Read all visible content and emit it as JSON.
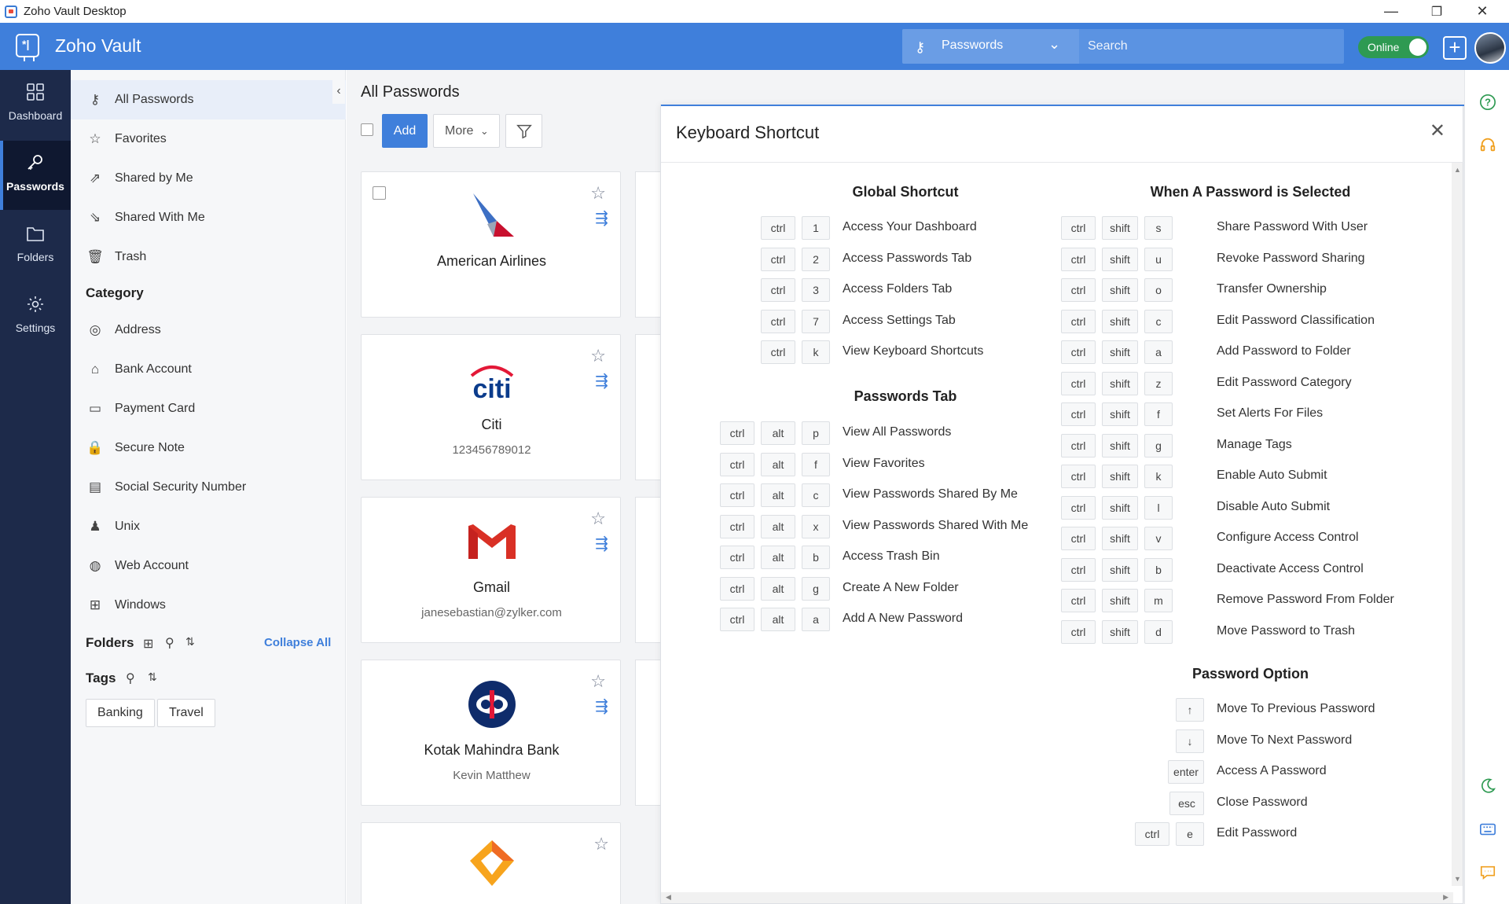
{
  "window": {
    "title": "Zoho Vault Desktop",
    "min": "—",
    "restore": "❐",
    "close": "✕"
  },
  "header": {
    "brand": "Zoho Vault",
    "search_scope": "Passwords",
    "search_placeholder": "Search",
    "online_label": "Online"
  },
  "nav": [
    {
      "label": "Dashboard",
      "icon": "grid-icon"
    },
    {
      "label": "Passwords",
      "icon": "key-icon",
      "active": true
    },
    {
      "label": "Folders",
      "icon": "folder-icon"
    },
    {
      "label": "Settings",
      "icon": "gear-icon"
    }
  ],
  "sidebar": {
    "items": [
      {
        "label": "All Passwords",
        "icon": "all-passwords-icon",
        "glyph": "⚷"
      },
      {
        "label": "Favorites",
        "icon": "star-icon",
        "glyph": "☆"
      },
      {
        "label": "Shared by Me",
        "icon": "share-out-icon",
        "glyph": "⇗"
      },
      {
        "label": "Shared With Me",
        "icon": "share-in-icon",
        "glyph": "⇘"
      },
      {
        "label": "Trash",
        "icon": "trash-icon",
        "glyph": "🗑"
      }
    ],
    "category_heading": "Category",
    "categories": [
      {
        "label": "Address",
        "icon": "address-icon",
        "glyph": "◎"
      },
      {
        "label": "Bank Account",
        "icon": "bank-icon",
        "glyph": "⌂"
      },
      {
        "label": "Payment Card",
        "icon": "card-icon",
        "glyph": "▭"
      },
      {
        "label": "Secure Note",
        "icon": "secure-note-icon",
        "glyph": "🔒"
      },
      {
        "label": "Social Security Number",
        "icon": "ssn-icon",
        "glyph": "▤"
      },
      {
        "label": "Unix",
        "icon": "linux-icon",
        "glyph": "♟"
      },
      {
        "label": "Web Account",
        "icon": "globe-icon",
        "glyph": "◍"
      },
      {
        "label": "Windows",
        "icon": "windows-icon",
        "glyph": "⊞"
      }
    ],
    "folders_heading": "Folders",
    "collapse_all": "Collapse All",
    "tags_heading": "Tags",
    "tags": [
      "Banking",
      "Travel"
    ]
  },
  "main": {
    "title": "All Passwords",
    "add_label": "Add",
    "more_label": "More",
    "cards": [
      {
        "name": "American Airlines",
        "sub": ""
      },
      {
        "name": "Citi",
        "sub": "123456789012"
      },
      {
        "name": "Gmail",
        "sub": "janesebastian@zylker.com"
      },
      {
        "name": "Kotak Mahindra Bank",
        "sub": "Kevin Matthew"
      },
      {
        "name": "",
        "sub": ""
      }
    ]
  },
  "modal": {
    "title": "Keyboard Shortcut",
    "global": {
      "heading": "Global Shortcut",
      "rows": [
        {
          "keys": [
            "ctrl",
            "1"
          ],
          "label": "Access Your Dashboard"
        },
        {
          "keys": [
            "ctrl",
            "2"
          ],
          "label": "Access Passwords Tab"
        },
        {
          "keys": [
            "ctrl",
            "3"
          ],
          "label": "Access Folders Tab"
        },
        {
          "keys": [
            "ctrl",
            "7"
          ],
          "label": "Access Settings Tab"
        },
        {
          "keys": [
            "ctrl",
            "k"
          ],
          "label": "View Keyboard Shortcuts"
        }
      ]
    },
    "passwords_tab": {
      "heading": "Passwords Tab",
      "rows": [
        {
          "keys": [
            "ctrl",
            "alt",
            "p"
          ],
          "label": "View All Passwords"
        },
        {
          "keys": [
            "ctrl",
            "alt",
            "f"
          ],
          "label": "View Favorites"
        },
        {
          "keys": [
            "ctrl",
            "alt",
            "c"
          ],
          "label": "View Passwords Shared By Me"
        },
        {
          "keys": [
            "ctrl",
            "alt",
            "x"
          ],
          "label": "View Passwords Shared With Me"
        },
        {
          "keys": [
            "ctrl",
            "alt",
            "b"
          ],
          "label": "Access Trash Bin"
        },
        {
          "keys": [
            "ctrl",
            "alt",
            "g"
          ],
          "label": "Create A New Folder"
        },
        {
          "keys": [
            "ctrl",
            "alt",
            "a"
          ],
          "label": "Add A New Password"
        }
      ]
    },
    "selected": {
      "heading": "When A Password is Selected",
      "rows": [
        {
          "keys": [
            "ctrl",
            "shift",
            "s"
          ],
          "label": "Share Password With User"
        },
        {
          "keys": [
            "ctrl",
            "shift",
            "u"
          ],
          "label": "Revoke Password Sharing"
        },
        {
          "keys": [
            "ctrl",
            "shift",
            "o"
          ],
          "label": "Transfer Ownership"
        },
        {
          "keys": [
            "ctrl",
            "shift",
            "c"
          ],
          "label": "Edit Password Classification"
        },
        {
          "keys": [
            "ctrl",
            "shift",
            "a"
          ],
          "label": "Add Password to Folder"
        },
        {
          "keys": [
            "ctrl",
            "shift",
            "z"
          ],
          "label": "Edit Password Category"
        },
        {
          "keys": [
            "ctrl",
            "shift",
            "f"
          ],
          "label": "Set Alerts For Files"
        },
        {
          "keys": [
            "ctrl",
            "shift",
            "g"
          ],
          "label": "Manage Tags"
        },
        {
          "keys": [
            "ctrl",
            "shift",
            "k"
          ],
          "label": "Enable Auto Submit"
        },
        {
          "keys": [
            "ctrl",
            "shift",
            "l"
          ],
          "label": "Disable Auto Submit"
        },
        {
          "keys": [
            "ctrl",
            "shift",
            "v"
          ],
          "label": "Configure Access Control"
        },
        {
          "keys": [
            "ctrl",
            "shift",
            "b"
          ],
          "label": "Deactivate Access Control"
        },
        {
          "keys": [
            "ctrl",
            "shift",
            "m"
          ],
          "label": "Remove Password From Folder"
        },
        {
          "keys": [
            "ctrl",
            "shift",
            "d"
          ],
          "label": "Move Password to Trash"
        }
      ]
    },
    "option": {
      "heading": "Password Option",
      "rows": [
        {
          "keys": [
            "↑"
          ],
          "label": "Move To Previous Password"
        },
        {
          "keys": [
            "↓"
          ],
          "label": "Move To Next Password"
        },
        {
          "keys": [
            "enter"
          ],
          "label": "Access A Password"
        },
        {
          "keys": [
            "esc"
          ],
          "label": "Close Password"
        },
        {
          "keys": [
            "ctrl",
            "e"
          ],
          "label": "Edit Password"
        }
      ]
    }
  },
  "colors": {
    "accent": "#3f7fdb",
    "nav_bg": "#1d2a4a",
    "online": "#2e9a52"
  }
}
